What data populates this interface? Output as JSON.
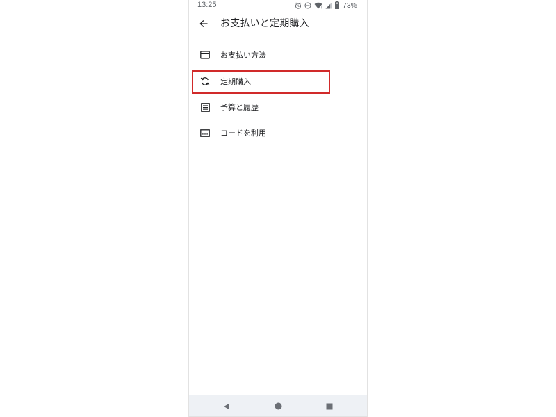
{
  "status_bar": {
    "time": "13:25",
    "battery_percent": "73%",
    "icons": [
      "alarm-icon",
      "do-not-disturb-icon",
      "wifi-icon",
      "signal-icon",
      "battery-icon"
    ]
  },
  "app_bar": {
    "back_icon": "arrow-back-icon",
    "title": "お支払いと定期購入"
  },
  "menu": {
    "items": [
      {
        "label": "お支払い方法",
        "icon": "credit-card-icon"
      },
      {
        "label": "定期購入",
        "icon": "sync-icon",
        "highlighted": true
      },
      {
        "label": "予算と履歴",
        "icon": "list-icon"
      },
      {
        "label": "コードを利用",
        "icon": "redeem-code-icon"
      }
    ]
  },
  "nav_bar": {
    "buttons": [
      "back-triangle-icon",
      "home-circle-icon",
      "recents-square-icon"
    ]
  },
  "colors": {
    "highlight": "#d12a2a",
    "text_primary": "#202124",
    "status_text": "#5f6368",
    "nav_bar_bg": "#eef1f5"
  }
}
